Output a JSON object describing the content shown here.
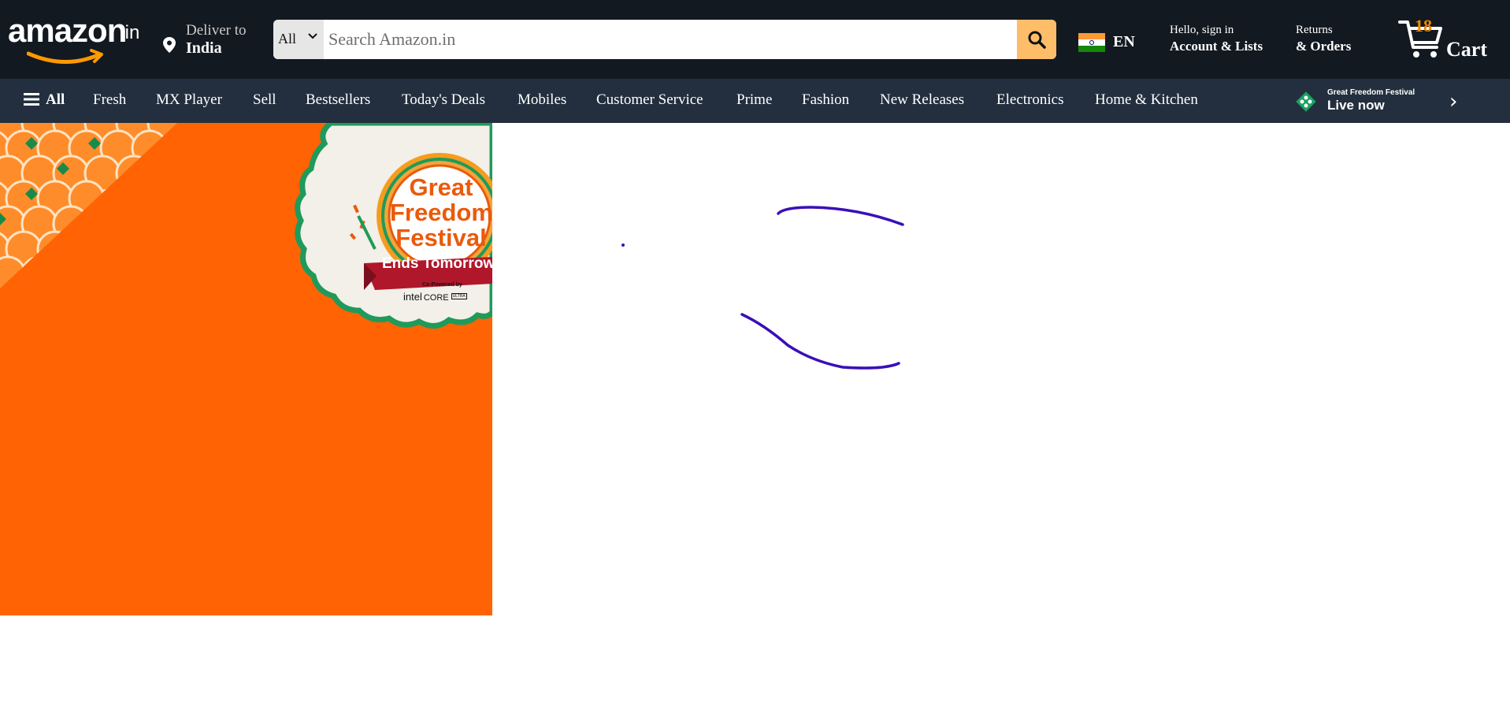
{
  "header": {
    "logo_text": "amazon",
    "logo_tld": ".in",
    "deliver_label": "Deliver to",
    "deliver_location": "India",
    "search": {
      "category": "All",
      "placeholder": "Search Amazon.in",
      "value": ""
    },
    "language": "EN",
    "account_line1": "Hello, sign in",
    "account_line2": "Account & Lists",
    "returns_line1": "Returns",
    "returns_line2": "& Orders",
    "cart_count": "18",
    "cart_label": "Cart"
  },
  "nav": {
    "all_label": "All",
    "items": [
      "Fresh",
      "MX Player",
      "Sell",
      "Bestsellers",
      "Today's Deals",
      "Mobiles",
      "Customer Service",
      "Prime",
      "Fashion",
      "New Releases",
      "Electronics",
      "Home & Kitchen"
    ],
    "promo_line1": "Great Freedom Festival",
    "promo_line2": "Live now",
    "next_arrow": "›"
  },
  "banner": {
    "title_line1": "Great",
    "title_line2": "Freedom",
    "title_line3": "Festival",
    "ribbon": "Ends Tomorrow",
    "copowered": "Co-Powered by",
    "sponsor": "intel",
    "sponsor_product": "CORE",
    "sponsor_tier": "ULTRA"
  },
  "colors": {
    "header_bg": "#131921",
    "nav_bg": "#232f3e",
    "search_button": "#febd69",
    "cart_count": "#f08804",
    "banner_orange": "#ff6304",
    "scribble": "#3a0fb8"
  },
  "icons": {
    "location": "location-pin-icon",
    "search": "search-icon",
    "cart": "cart-icon",
    "menu": "hamburger-menu-icon",
    "flag": "india-flag-icon"
  }
}
